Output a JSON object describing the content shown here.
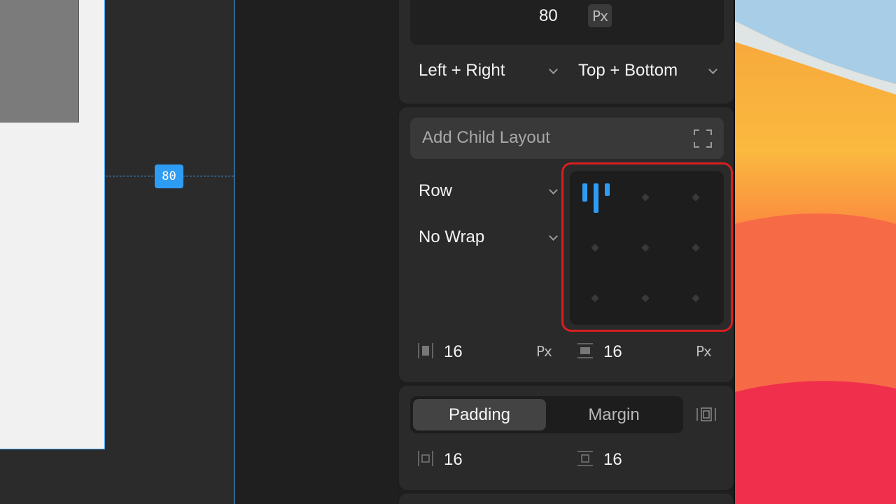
{
  "canvas": {
    "spacing_badge": "80"
  },
  "panel": {
    "size": {
      "value": "80",
      "unit": "Px"
    },
    "constraints": {
      "horizontal": "Left + Right",
      "vertical": "Top + Bottom"
    },
    "layout": {
      "add_child_label": "Add Child Layout",
      "direction": "Row",
      "wrap": "No Wrap",
      "alignment": "top-left",
      "column_gap": {
        "value": "16",
        "unit": "Px"
      },
      "row_gap": {
        "value": "16",
        "unit": "Px"
      }
    },
    "spacing": {
      "tabs": {
        "padding": "Padding",
        "margin": "Margin"
      },
      "active_tab": "Padding",
      "horizontal": "16",
      "vertical": "16"
    }
  },
  "colors": {
    "accent": "#2f9cf4",
    "highlight": "#d71f1f",
    "panel_bg": "#2a2a2a"
  },
  "icons": [
    "expand-icon",
    "column-gap-icon",
    "row-gap-icon",
    "padding-sides-icon",
    "padding-horizontal-icon",
    "padding-vertical-icon",
    "chevron-down-icon"
  ]
}
